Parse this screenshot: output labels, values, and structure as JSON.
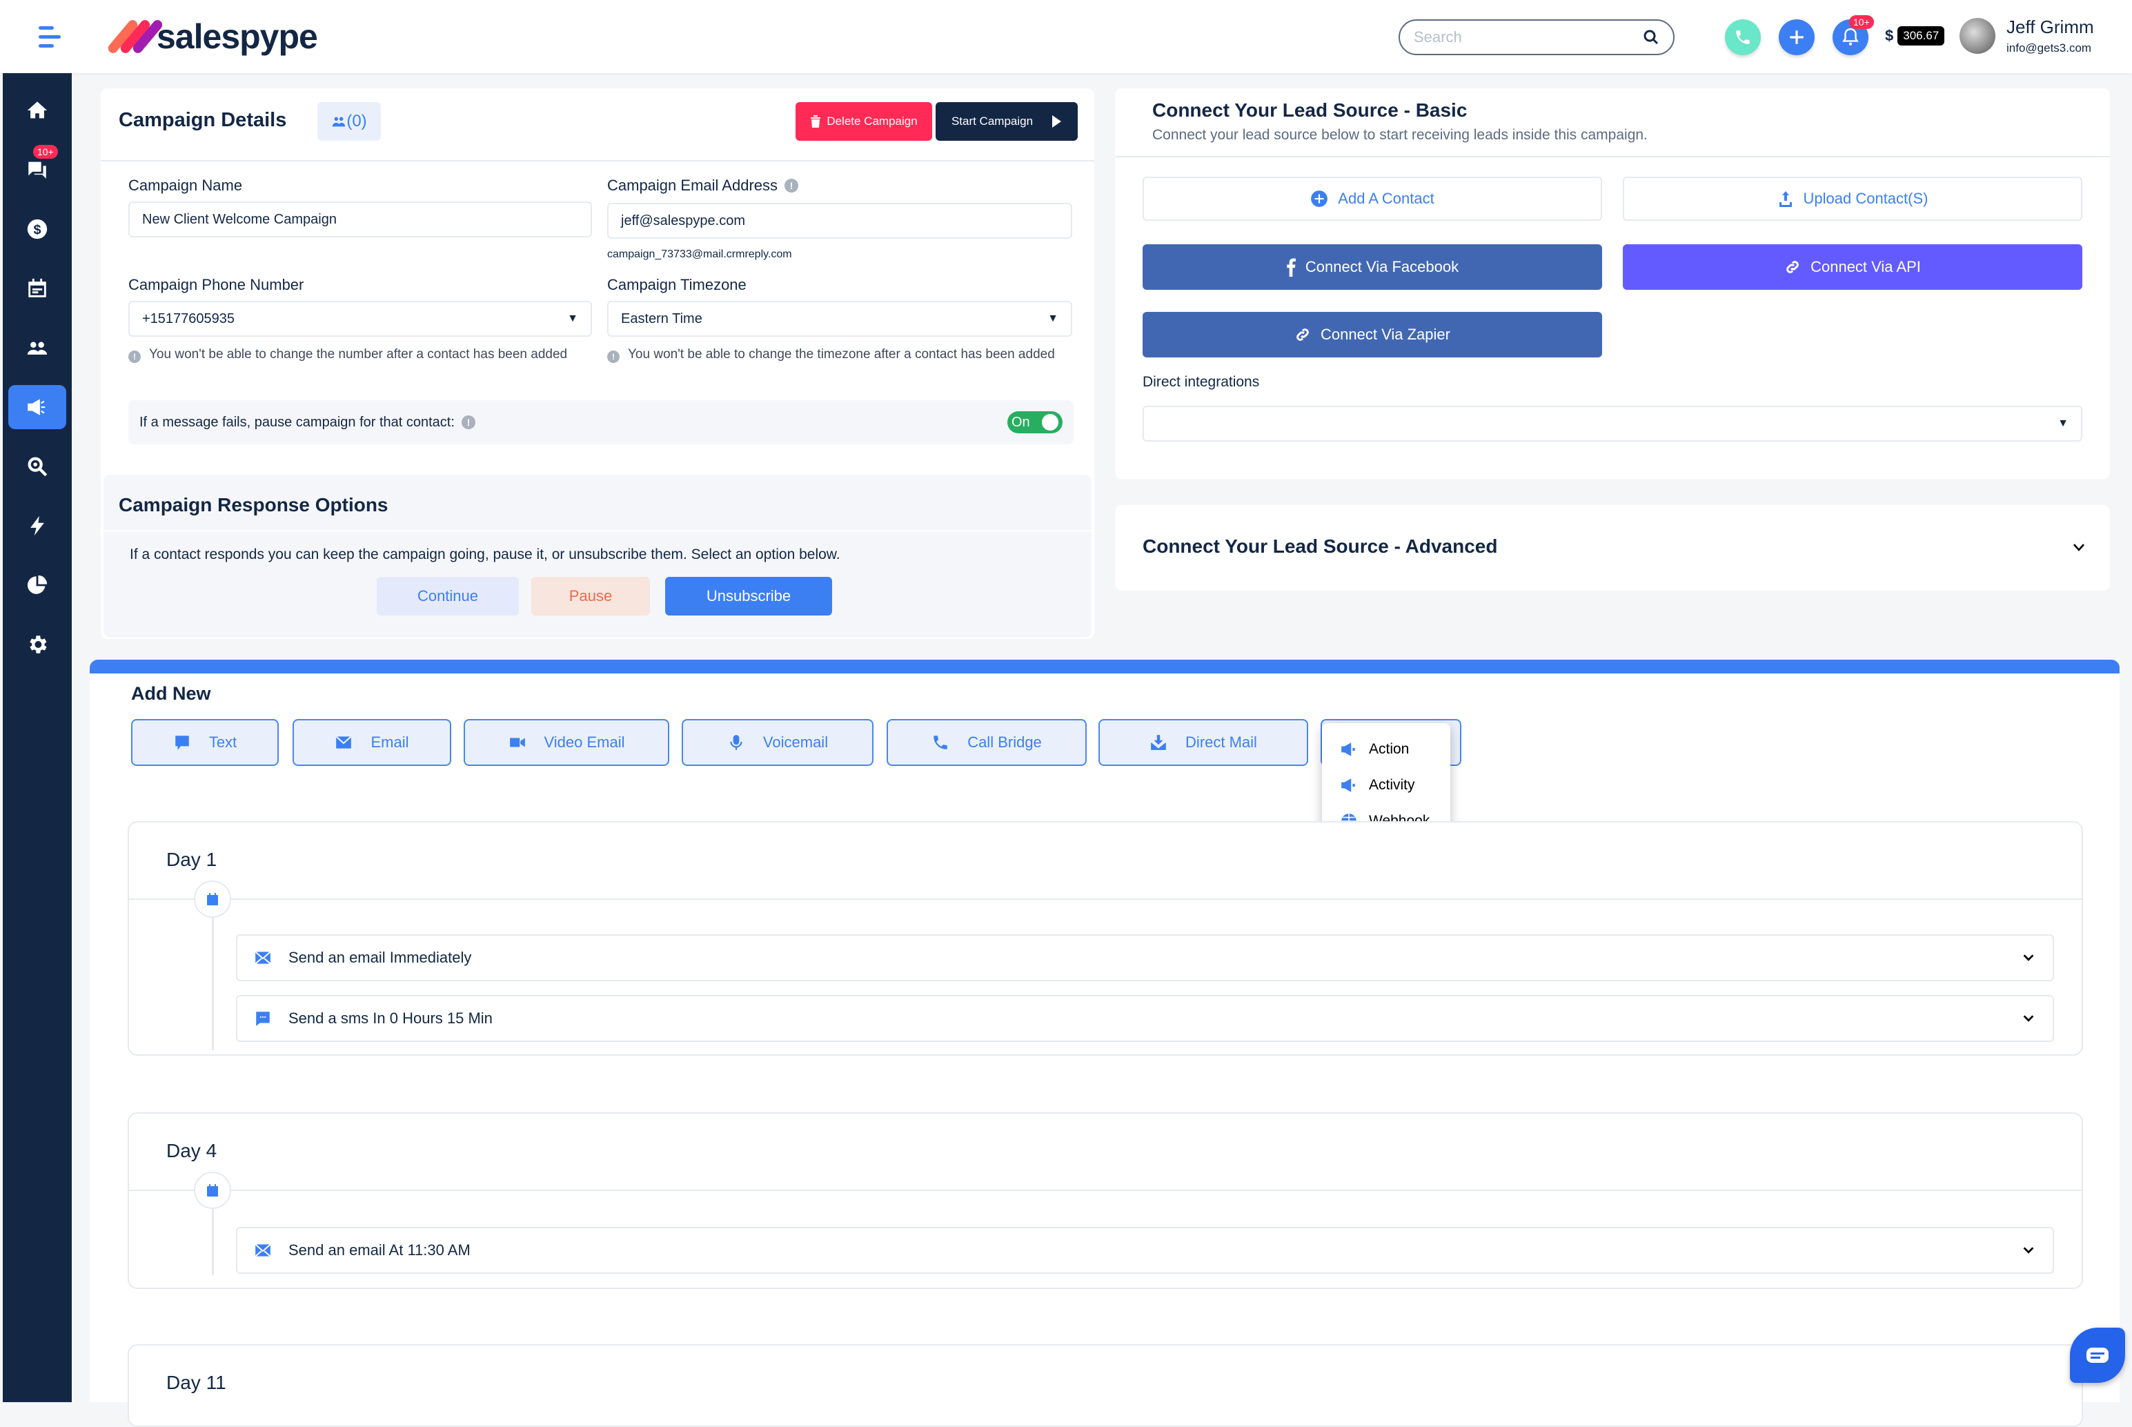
{
  "header": {
    "brand": "salespype",
    "search_placeholder": "Search",
    "notifications_badge": "10+",
    "balance_currency": "$",
    "balance_amount": "306.67",
    "user_name": "Jeff Grimm",
    "user_email": "info@gets3.com"
  },
  "sidebar": {
    "items": [
      {
        "name": "home",
        "icon": "home-icon"
      },
      {
        "name": "messages",
        "icon": "chat-icon",
        "badge": "10+"
      },
      {
        "name": "billing",
        "icon": "dollar-icon"
      },
      {
        "name": "calendar",
        "icon": "calendar-icon"
      },
      {
        "name": "contacts",
        "icon": "users-icon"
      },
      {
        "name": "campaigns",
        "icon": "megaphone-icon",
        "active": true
      },
      {
        "name": "search",
        "icon": "search-icon"
      },
      {
        "name": "triggers",
        "icon": "bolt-icon"
      },
      {
        "name": "reports",
        "icon": "pie-chart-icon"
      },
      {
        "name": "settings",
        "icon": "gear-icon"
      }
    ],
    "messages_badge": "10+"
  },
  "campaign_details": {
    "title": "Campaign Details",
    "contacts_count": "(0)",
    "delete_label": "Delete Campaign",
    "start_label": "Start Campaign",
    "name_label": "Campaign Name",
    "name_value": "New Client Welcome Campaign",
    "email_label": "Campaign Email Address",
    "email_value": "jeff@salespype.com",
    "reply_email": "campaign_73733@mail.crmreply.com",
    "phone_label": "Campaign Phone Number",
    "phone_value": "+15177605935",
    "timezone_label": "Campaign Timezone",
    "timezone_value": "Eastern Time",
    "phone_hint": "You won't be able to change the number after a contact has been added",
    "timezone_hint": "You won't be able to change the timezone after a contact has been added",
    "pause_label": "If a message fails, pause campaign for that contact:",
    "pause_toggle": "On"
  },
  "response_options": {
    "title": "Campaign Response Options",
    "description": "If a contact responds you can keep the campaign going, pause it, or unsubscribe them. Select an option below.",
    "continue_label": "Continue",
    "pause_label": "Pause",
    "unsubscribe_label": "Unsubscribe"
  },
  "lead_basic": {
    "title": "Connect Your Lead Source - Basic",
    "subtitle": "Connect your lead source below to start receiving leads inside this campaign.",
    "add_contact": "Add A Contact",
    "upload_contacts": "Upload Contact(S)",
    "facebook": "Connect Via Facebook",
    "api": "Connect Via API",
    "zapier": "Connect Via Zapier",
    "direct_label": "Direct integrations",
    "direct_value": ""
  },
  "lead_advanced": {
    "title": "Connect Your Lead Source - Advanced"
  },
  "add_new": {
    "title": "Add New",
    "buttons": [
      "Text",
      "Email",
      "Video Email",
      "Voicemail",
      "Call Bridge",
      "Direct Mail"
    ],
    "dropdown": [
      "Action",
      "Activity",
      "Webhook"
    ]
  },
  "days": [
    {
      "title": "Day 1",
      "steps": [
        "Send an email Immediately",
        "Send a sms In 0 Hours 15 Min"
      ]
    },
    {
      "title": "Day 4",
      "steps": [
        "Send an email At 11:30 AM"
      ]
    },
    {
      "title": "Day 11",
      "steps": []
    }
  ],
  "colors": {
    "primary": "#3c7ff2",
    "navy": "#132745",
    "danger": "#ff2a55",
    "facebook": "#4267b2",
    "api": "#635bff",
    "success": "#27ae60",
    "phone": "#6ae6c8"
  }
}
